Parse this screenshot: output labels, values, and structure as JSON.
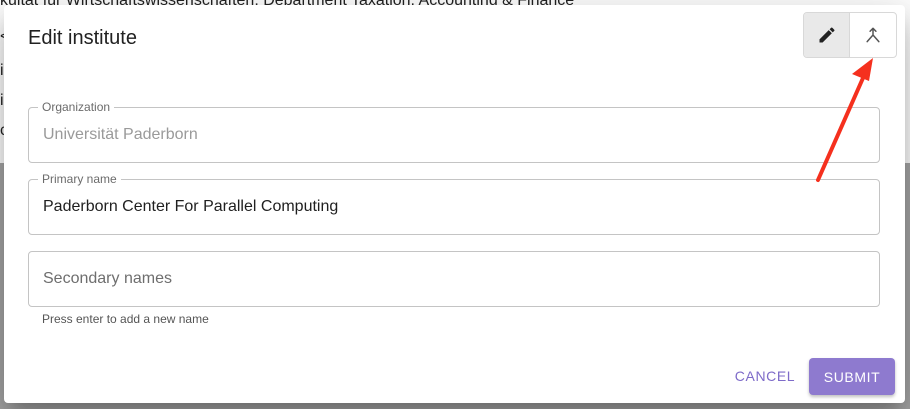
{
  "background": {
    "line_top": "kultät für Wirtschaftswissenschaften, Department Taxation, Accounting & Finance",
    "line_left_1": "<",
    "line_left_2": "i",
    "line_left_3": "i",
    "line_left_4": "c"
  },
  "dialog": {
    "title": "Edit institute",
    "toggles": [
      {
        "icon": "pencil-icon",
        "selected": true
      },
      {
        "icon": "merge-icon",
        "selected": false
      }
    ]
  },
  "form": {
    "organization": {
      "label": "Organization",
      "value": "Universität Paderborn",
      "disabled": true
    },
    "primary_name": {
      "label": "Primary name",
      "value": "Paderborn Center For Parallel Computing"
    },
    "secondary_names": {
      "placeholder": "Secondary names",
      "helper": "Press enter to add a new name"
    }
  },
  "actions": {
    "cancel": "CANCEL",
    "submit": "SUBMIT"
  },
  "colors": {
    "accent": "#8e7acf",
    "annotation_arrow": "#f5301e"
  }
}
